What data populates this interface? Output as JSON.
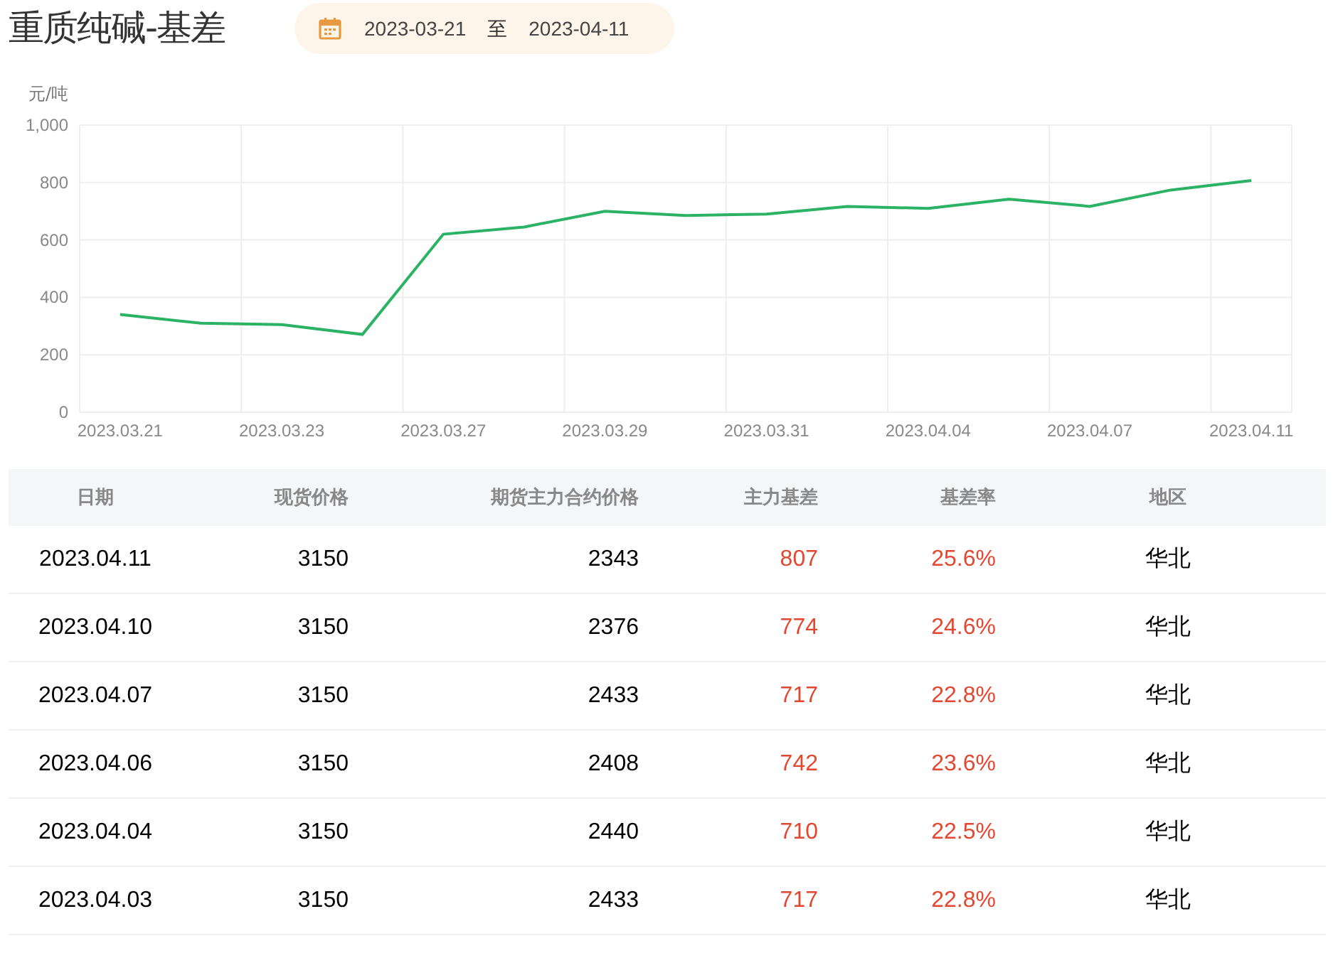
{
  "title": "重质纯碱-基差",
  "date_range": {
    "start": "2023-03-21",
    "separator": "至",
    "end": "2023-04-11"
  },
  "chart": {
    "chart_data": {
      "type": "line",
      "ylabel": "元/吨",
      "categories": [
        "2023.03.21",
        null,
        "2023.03.23",
        null,
        "2023.03.27",
        null,
        "2023.03.29",
        null,
        "2023.03.31",
        null,
        "2023.04.04",
        null,
        "2023.04.07",
        null,
        "2023.04.11"
      ],
      "series": [
        {
          "color": "#2bb265",
          "values": [
            340,
            310,
            305,
            271,
            620,
            645,
            700,
            685,
            690,
            717,
            710,
            742,
            717,
            774,
            807
          ]
        }
      ],
      "grid": true,
      "ylim": [
        0,
        1000
      ],
      "yticks": [
        {
          "value": 0,
          "label": "0"
        },
        {
          "value": 200,
          "label": "200"
        },
        {
          "value": 400,
          "label": "400"
        },
        {
          "value": 600,
          "label": "600"
        },
        {
          "value": 800,
          "label": "800"
        },
        {
          "value": 1000,
          "label": "1,000"
        }
      ]
    }
  },
  "table": {
    "columns": [
      "日期",
      "现货价格",
      "期货主力合约价格",
      "主力基差",
      "基差率",
      "地区"
    ],
    "rows": [
      [
        "2023.04.11",
        "3150",
        "2343",
        "807",
        "25.6%",
        "华北"
      ],
      [
        "2023.04.10",
        "3150",
        "2376",
        "774",
        "24.6%",
        "华北"
      ],
      [
        "2023.04.07",
        "3150",
        "2433",
        "717",
        "22.8%",
        "华北"
      ],
      [
        "2023.04.06",
        "3150",
        "2408",
        "742",
        "23.6%",
        "华北"
      ],
      [
        "2023.04.04",
        "3150",
        "2440",
        "710",
        "22.5%",
        "华北"
      ],
      [
        "2023.04.03",
        "3150",
        "2433",
        "717",
        "22.8%",
        "华北"
      ]
    ]
  }
}
